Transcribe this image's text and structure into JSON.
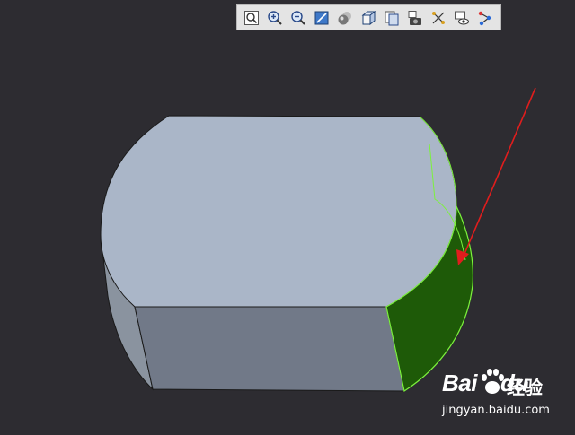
{
  "toolbar": {
    "buttons": [
      {
        "name": "zoom-fit-icon"
      },
      {
        "name": "zoom-in-icon"
      },
      {
        "name": "zoom-out-icon"
      },
      {
        "name": "zoom-window-icon"
      },
      {
        "name": "shading-icon"
      },
      {
        "name": "view-orientation-icon"
      },
      {
        "name": "section-view-icon"
      },
      {
        "name": "screenshot-camera-icon"
      },
      {
        "name": "selection-filter-icon"
      },
      {
        "name": "hide-show-icon"
      },
      {
        "name": "display-style-icon"
      }
    ]
  },
  "model": {
    "top_face_color": "#aab6c8",
    "front_face_color": "#717988",
    "left_face_color": "#8a939f",
    "selected_face_color": "#1e5a08",
    "selection_edge_color": "#7cf23c",
    "annotation_arrow_color": "#e01d1d"
  },
  "watermark": {
    "logo": "Bai",
    "logo_suffix": "du",
    "brand_cn": "经验",
    "url": "jingyan.baidu.com"
  }
}
